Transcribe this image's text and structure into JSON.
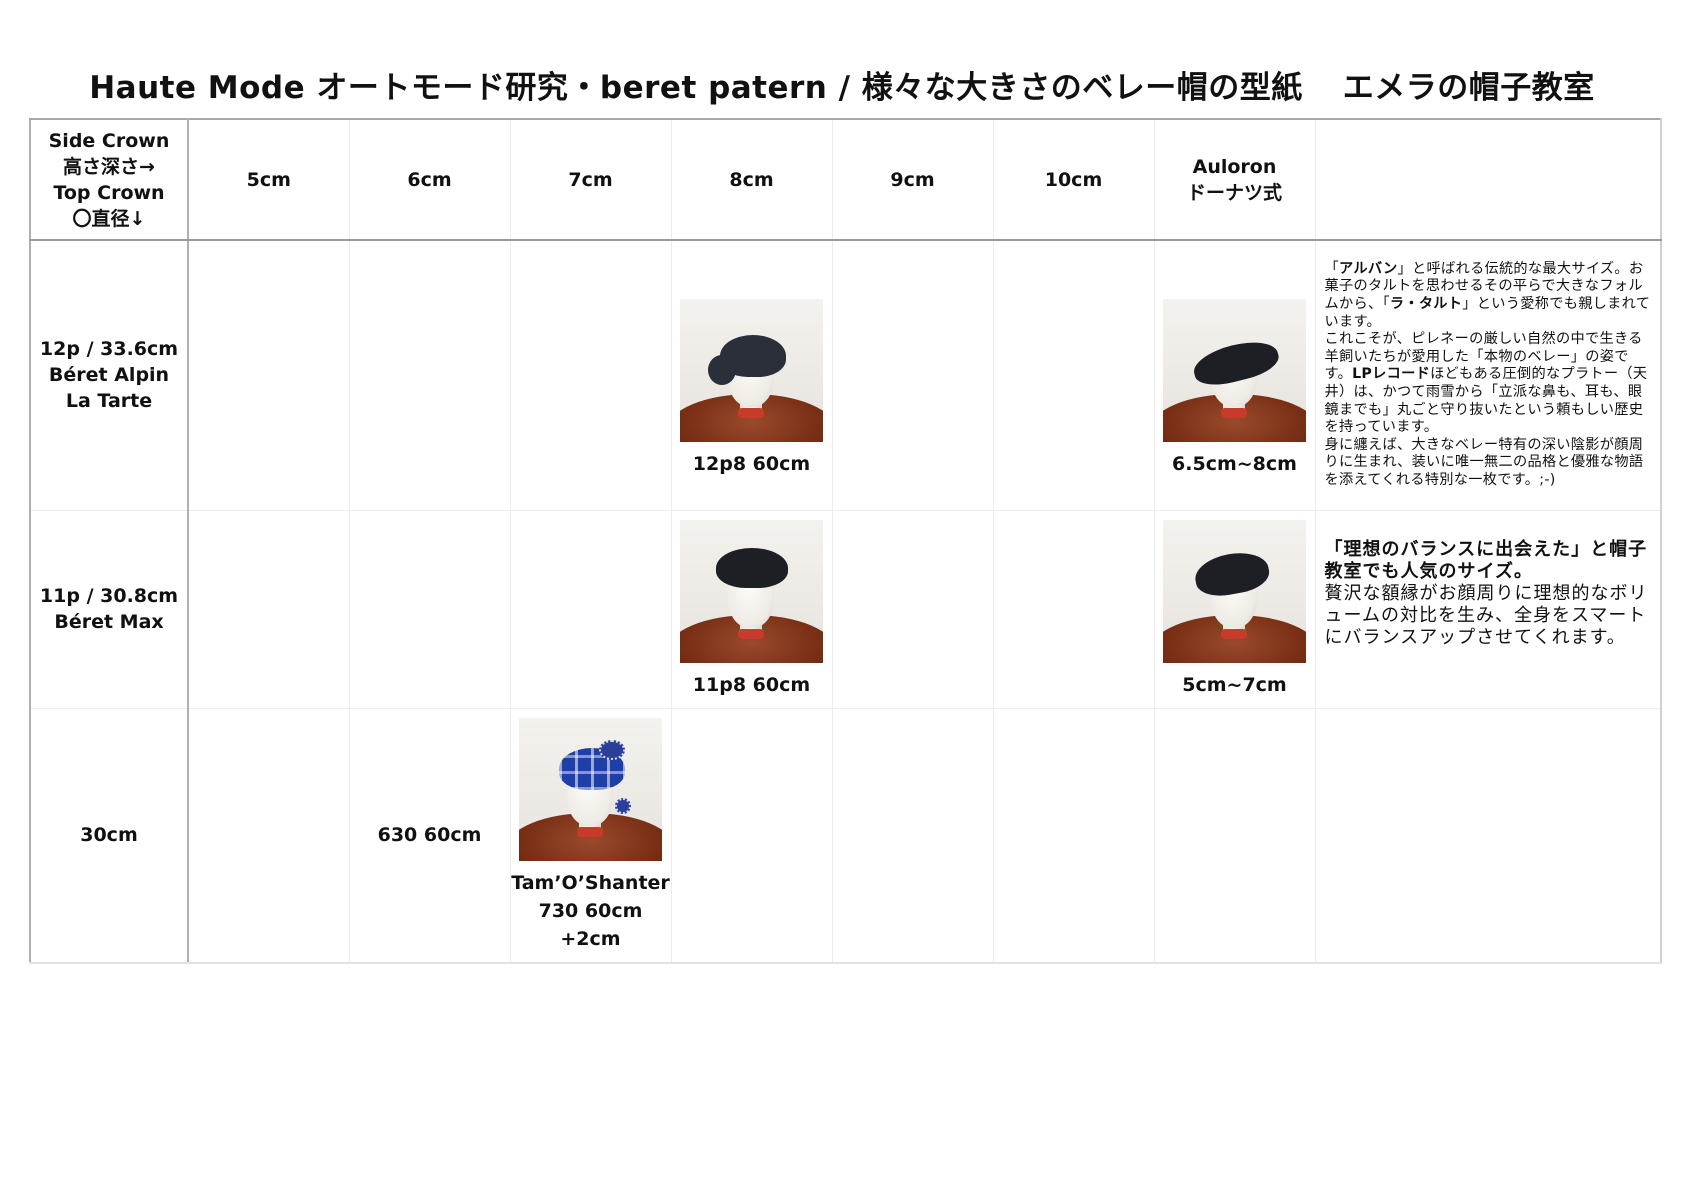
{
  "header": {
    "title_left": "Haute Mode オートモード研究・beret patern / 様々な大きさのベレー帽の型紙",
    "title_right": "エメラの帽子教室"
  },
  "table": {
    "corner_lines": [
      "Side Crown",
      "高さ深さ→",
      "Top Crown",
      "〇直径↓"
    ],
    "columns": [
      "5cm",
      "6cm",
      "7cm",
      "8cm",
      "9cm",
      "10cm"
    ],
    "auloron_lines": [
      "Auloron",
      "ドーナツ式"
    ],
    "rows": [
      {
        "label_lines": [
          "12p / 33.6cm",
          "Béret Alpin",
          "La Tarte"
        ],
        "photo_8cm_caption": "12p8 60cm",
        "photo_8cm_icon": "navy-beret-photo",
        "auloron_caption": "6.5cm~8cm",
        "auloron_icon": "black-beret-photo",
        "description": {
          "p1_open": "「",
          "p1_bold": "アルバン",
          "p1_rest": "」と呼ばれる伝統的な最大サイズ。お菓子のタルトを思わせるその平らで大きなフォルムから、「",
          "p1_bold2": "ラ・タルト",
          "p1_end": "」という愛称でも親しまれています。",
          "p2": "これこそが、ピレネーの厳しい自然の中で生きる羊飼いたちが愛用した「本物のベレー」の姿です。",
          "p2_bold": "LPレコード",
          "p2_rest": "ほどもある圧倒的なプラトー（天井）は、かつて雨雪から「立派な鼻も、耳も、眼鏡までも」丸ごと守り抜いたという頼もしい歴史を持っています。",
          "p3": "身に纏えば、大きなベレー特有の深い陰影が顔周りに生まれ、装いに唯一無二の品格と優雅な物語を添えてくれる特別な一枚です。;-)"
        }
      },
      {
        "label_lines": [
          "11p / 30.8cm",
          "Béret Max"
        ],
        "photo_8cm_caption": "11p8 60cm",
        "photo_8cm_icon": "black-beret-photo",
        "auloron_caption": "5cm~7cm",
        "auloron_icon": "black-beret-photo",
        "description": {
          "bold": "「理想のバランスに出会えた」と帽子教室でも人気のサイズ。",
          "text": "贅沢な額縁がお顔周りに理想的なボリュームの対比を生み、全身をスマートにバランスアップさせてくれます。"
        }
      },
      {
        "label_lines": [
          "30cm"
        ],
        "text_6cm": "630 60cm",
        "photo_7cm_icon": "plaid-tam-o-shanter-photo",
        "caption_7cm_lines": [
          "Tam’O’Shanter",
          "730 60cm",
          "+2cm"
        ]
      }
    ]
  },
  "colors": {
    "header_border": "#9a9a9a",
    "grid_line": "#ececec",
    "table_wood": "#7a3016",
    "plaid_blue": "#1f3fa8"
  }
}
